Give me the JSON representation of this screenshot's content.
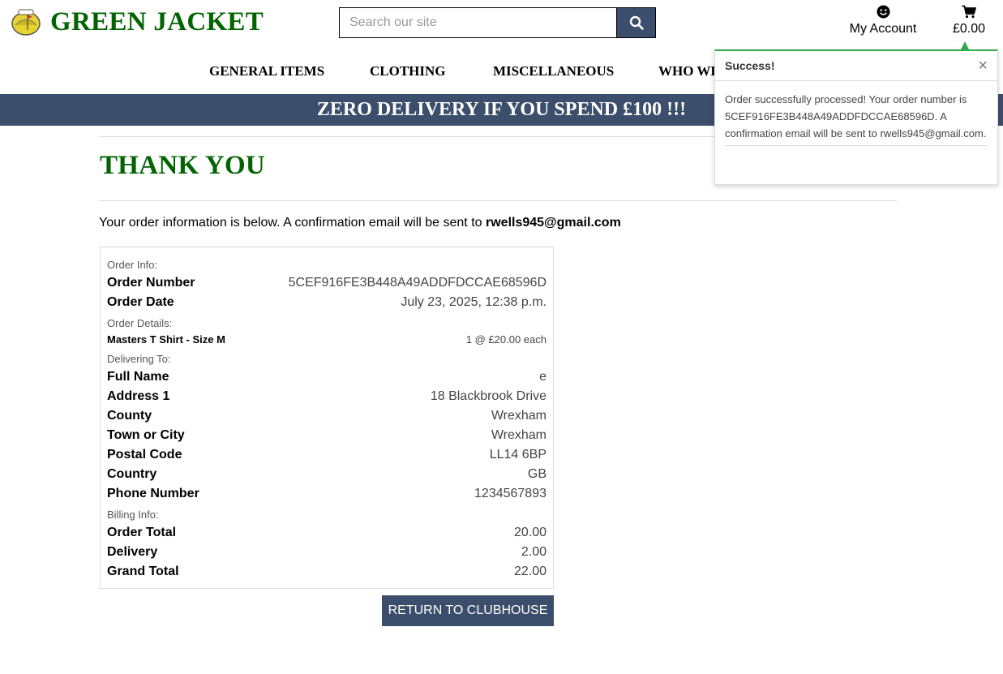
{
  "header": {
    "brand": "GREEN JACKET",
    "search_placeholder": "Search our site",
    "account_label": "My Account",
    "cart_total": "£0.00"
  },
  "nav": {
    "items": [
      "GENERAL ITEMS",
      "CLOTHING",
      "MISCELLANEOUS",
      "WHO WE"
    ]
  },
  "banner": {
    "text": "ZERO DELIVERY IF YOU SPEND £100 !!!"
  },
  "main": {
    "title": "THANK YOU",
    "intro_text": "Your order information is below. A confirmation email will be sent to",
    "intro_email": "rwells945@gmail.com"
  },
  "order": {
    "order_info_label": "Order Info:",
    "order_number_label": "Order Number",
    "order_number": "5CEF916FE3B448A49ADDFDCCAE68596D",
    "order_date_label": "Order Date",
    "order_date": "July 23, 2025, 12:38 p.m.",
    "order_details_label": "Order Details:",
    "item_name": "Masters T Shirt - Size M",
    "item_qty": "1 @ £20.00 each",
    "delivering_label": "Delivering To:",
    "full_name_label": "Full Name",
    "full_name": "e",
    "address1_label": "Address 1",
    "address1": "18 Blackbrook Drive",
    "county_label": "County",
    "county": "Wrexham",
    "town_label": "Town or City",
    "town": "Wrexham",
    "postcode_label": "Postal Code",
    "postcode": "LL14 6BP",
    "country_label": "Country",
    "country": "GB",
    "phone_label": "Phone Number",
    "phone": "1234567893",
    "billing_label": "Billing Info:",
    "order_total_label": "Order Total",
    "order_total": "20.00",
    "delivery_label": "Delivery",
    "delivery": "2.00",
    "grand_total_label": "Grand Total",
    "grand_total": "22.00"
  },
  "return_button": "RETURN TO CLUBHOUSE",
  "toast": {
    "title": "Success!",
    "close": "×",
    "message": "Order successfully processed! Your order number is 5CEF916FE3B448A49ADDFDCCAE68596D. A confirmation email will be sent to rwells945@gmail.com."
  },
  "colors": {
    "brand_green": "#006400",
    "navy": "#3b4e6b",
    "success_green": "#2fa84f"
  },
  "icons": {
    "logo": "masters-logo-icon",
    "search": "search-icon",
    "account": "smiley-icon",
    "cart": "cart-icon"
  }
}
